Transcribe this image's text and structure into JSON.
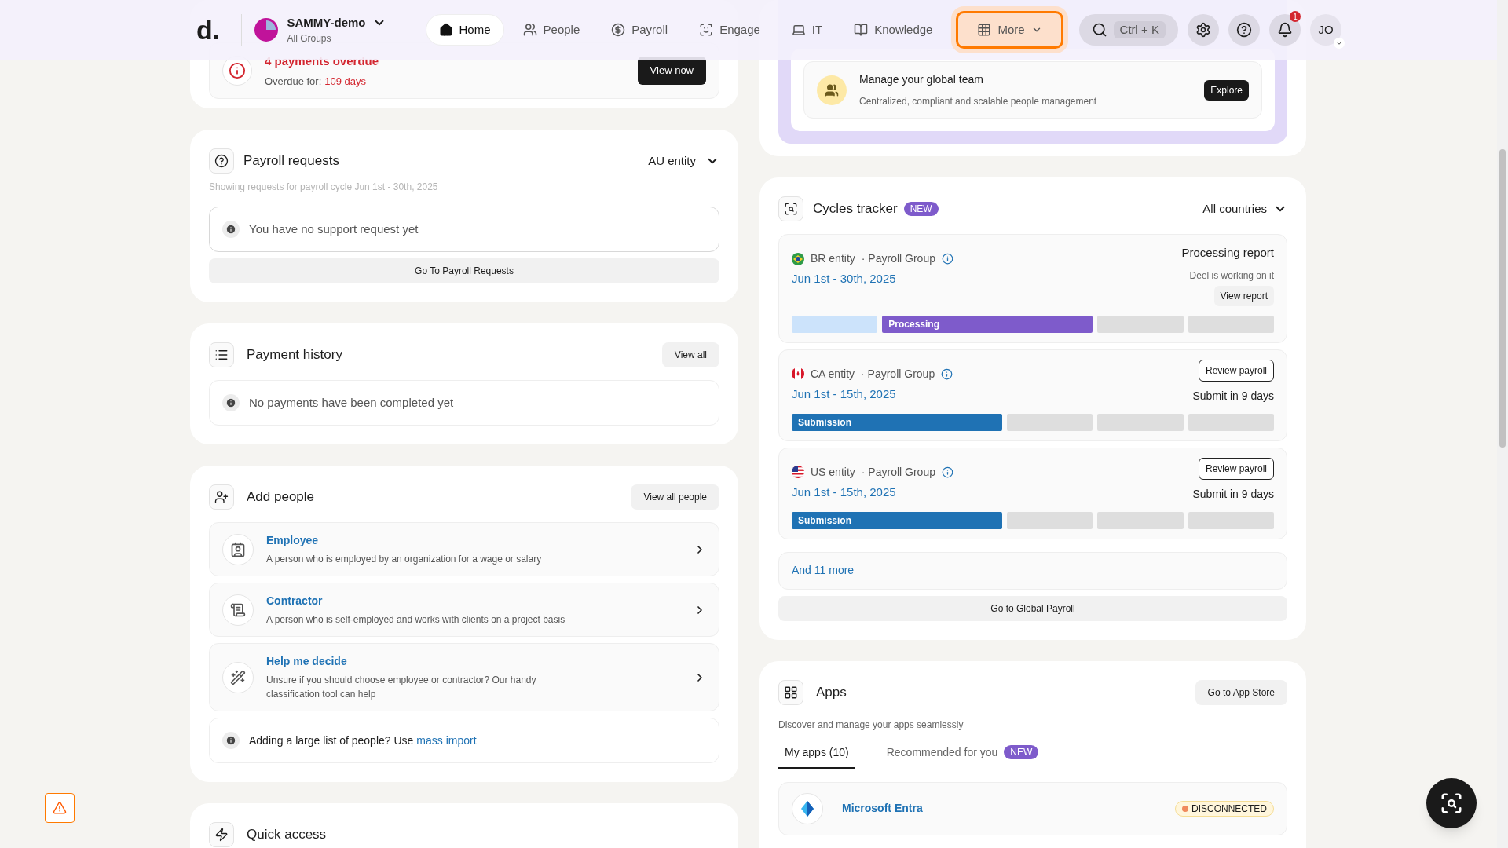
{
  "header": {
    "logo": "d.",
    "org": {
      "name": "SAMMY-demo",
      "group": "All Groups"
    },
    "nav": [
      {
        "label": "Home",
        "selected": true,
        "highlighted": false
      },
      {
        "label": "People",
        "selected": false,
        "highlighted": false
      },
      {
        "label": "Payroll",
        "selected": false,
        "highlighted": false
      },
      {
        "label": "Engage",
        "selected": false,
        "highlighted": false
      },
      {
        "label": "IT",
        "selected": false,
        "highlighted": false
      },
      {
        "label": "Knowledge",
        "selected": false,
        "highlighted": false
      },
      {
        "label": "More",
        "selected": false,
        "highlighted": true
      }
    ],
    "search_shortcut": "Ctrl + K",
    "notifications_count": "1",
    "avatar": "JO"
  },
  "overdue_card": {
    "title": "4 payments overdue",
    "label": "Overdue for:",
    "value": "109 days",
    "button": "View now"
  },
  "payroll_requests": {
    "title": "Payroll requests",
    "filter": "AU entity",
    "subtitle": "Showing requests for payroll cycle Jun 1st - 30th, 2025",
    "empty": "You have no support request yet",
    "button": "Go To Payroll Requests"
  },
  "payment_history": {
    "title": "Payment history",
    "button": "View all",
    "empty": "No payments have been completed yet"
  },
  "add_people": {
    "title": "Add people",
    "button": "View all people",
    "options": [
      {
        "kind": "employee",
        "title": "Employee",
        "description": "A person who is employed by an organization for a wage or salary"
      },
      {
        "kind": "contractor",
        "title": "Contractor",
        "description": "A person who is self-employed and works with clients on a project basis"
      },
      {
        "kind": "decide",
        "title": "Help me decide",
        "description": "Unsure if you should choose employee or contractor? Our handy classification tool can help"
      }
    ],
    "note": "Adding a large list of people? Use",
    "note_link": "mass import"
  },
  "quick_access": {
    "title": "Quick access"
  },
  "promo": {
    "title": "Manage your global team",
    "description": "Centralized, compliant and scalable people management",
    "button": "Explore"
  },
  "cycles_tracker": {
    "title": "Cycles tracker",
    "badge": "NEW",
    "filter": "All countries",
    "cycles": [
      {
        "entity": "BR entity",
        "group": "· Payroll Group",
        "dates": "Jun 1st - 30th, 2025",
        "kind": "report",
        "status": "Processing report",
        "note": "Deel is working on it",
        "button": "View report",
        "stages": [
          {
            "kind": "done"
          },
          {
            "kind": "active",
            "label": "Processing",
            "color": "#7e5bcb"
          },
          {
            "kind": "pending"
          },
          {
            "kind": "pending"
          }
        ]
      },
      {
        "entity": "CA entity",
        "group": "· Payroll Group",
        "dates": "Jun 1st - 15th, 2025",
        "kind": "review",
        "button": "Review payroll",
        "note": "Submit in 9 days",
        "stages": [
          {
            "kind": "active",
            "label": "Submission",
            "color": "#1f72b4"
          },
          {
            "kind": "pending"
          },
          {
            "kind": "pending"
          },
          {
            "kind": "pending"
          }
        ]
      },
      {
        "entity": "US entity",
        "group": "· Payroll Group",
        "dates": "Jun 1st - 15th, 2025",
        "kind": "review",
        "button": "Review payroll",
        "note": "Submit in 9 days",
        "stages": [
          {
            "kind": "active",
            "label": "Submission",
            "color": "#1f72b4"
          },
          {
            "kind": "pending"
          },
          {
            "kind": "pending"
          },
          {
            "kind": "pending"
          }
        ]
      }
    ],
    "more": "And 11 more",
    "button": "Go to Global Payroll"
  },
  "apps": {
    "title": "Apps",
    "button": "Go to App Store",
    "subtitle": "Discover and manage your apps seamlessly",
    "tabs": [
      {
        "label": "My apps (10)",
        "selected": true
      },
      {
        "label": "Recommended for you",
        "selected": false,
        "badge": "NEW"
      }
    ],
    "items": [
      {
        "name": "Microsoft Entra",
        "status": "DISCONNECTED",
        "color": "#f08a5d"
      }
    ]
  }
}
